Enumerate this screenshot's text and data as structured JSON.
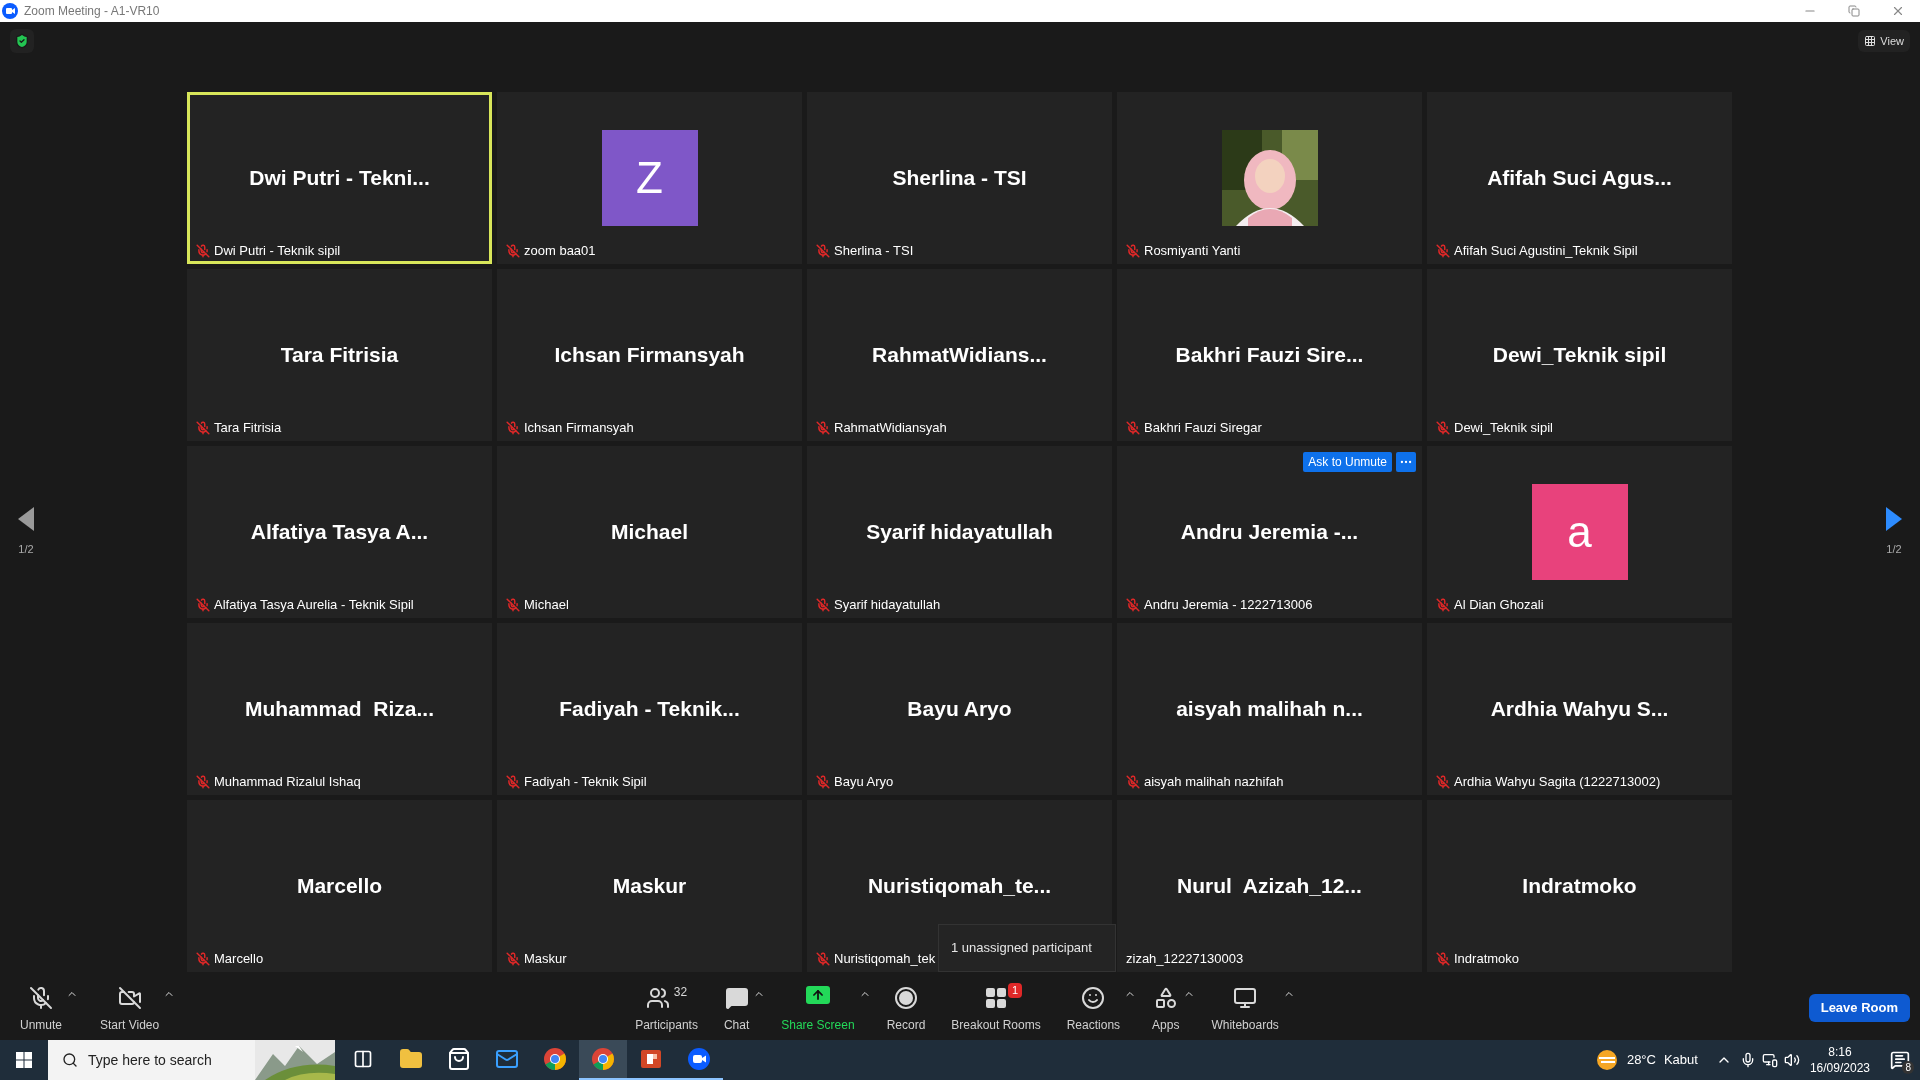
{
  "window": {
    "title": "Zoom Meeting - A1-VR10"
  },
  "view_button": "View",
  "pager": {
    "previous": {
      "label": "1/2",
      "enabled": false
    },
    "next": {
      "label": "1/2",
      "enabled": true
    }
  },
  "tiles": [
    {
      "kind": "name",
      "display": "Dwi Putri - Tekni...",
      "label": "Dwi Putri - Teknik sipil",
      "muted": true,
      "selected": true
    },
    {
      "kind": "avatar",
      "display": "Z",
      "color": "#7f57c8",
      "label": "zoom baa01",
      "muted": true,
      "selected": false
    },
    {
      "kind": "name",
      "display": "Sherlina - TSI",
      "label": "Sherlina - TSI",
      "muted": true,
      "selected": false
    },
    {
      "label": "Rosmiyanti Yanti",
      "muted": true,
      "selected": false
    },
    {
      "kind": "name",
      "display": "Afifah Suci Agus...",
      "label": "Afifah Suci Agustini_Teknik Sipil",
      "muted": true,
      "selected": false
    },
    {
      "kind": "name",
      "display": "Tara Fitrisia",
      "label": "Tara Fitrisia",
      "muted": true,
      "selected": false
    },
    {
      "kind": "name",
      "display": "Ichsan Firmansyah",
      "label": "Ichsan Firmansyah",
      "muted": true,
      "selected": false
    },
    {
      "kind": "name",
      "display": "RahmatWidians...",
      "label": "RahmatWidiansyah",
      "muted": true,
      "selected": false
    },
    {
      "kind": "name",
      "display": "Bakhri Fauzi Sire...",
      "label": "Bakhri Fauzi Siregar",
      "muted": true,
      "selected": false
    },
    {
      "kind": "name",
      "display": "Dewi_Teknik sipil",
      "label": "Dewi_Teknik sipil",
      "muted": true,
      "selected": false
    },
    {
      "kind": "name",
      "display": "Alfatiya Tasya A...",
      "label": "Alfatiya Tasya Aurelia - Teknik Sipil",
      "muted": true,
      "selected": false
    },
    {
      "kind": "name",
      "display": "Michael",
      "label": "Michael",
      "muted": true,
      "selected": false
    },
    {
      "kind": "name",
      "display": "Syarif hidayatullah",
      "label": "Syarif hidayatullah",
      "muted": true,
      "selected": false
    },
    {
      "kind": "name",
      "display": "Andru Jeremia -...",
      "label": "Andru Jeremia - 1222713006",
      "muted": true,
      "selected": false,
      "hover_action": "Ask to Unmute"
    },
    {
      "kind": "avatar",
      "display": "a",
      "color": "#e8427c",
      "label": "Al Dian Ghozali",
      "muted": true,
      "selected": false
    },
    {
      "kind": "name",
      "display": "Muhammad  Riza...",
      "label": "Muhammad Rizalul Ishaq",
      "muted": true,
      "selected": false
    },
    {
      "kind": "name",
      "display": "Fadiyah - Teknik...",
      "label": "Fadiyah - Teknik Sipil",
      "muted": true,
      "selected": false
    },
    {
      "kind": "name",
      "display": "Bayu Aryo",
      "label": "Bayu Aryo",
      "muted": true,
      "selected": false
    },
    {
      "kind": "name",
      "display": "aisyah malihah n...",
      "label": "aisyah malihah nazhifah",
      "muted": true,
      "selected": false
    },
    {
      "kind": "name",
      "display": "Ardhia Wahyu S...",
      "label": "Ardhia Wahyu Sagita (1222713002)",
      "muted": true,
      "selected": false
    },
    {
      "kind": "name",
      "display": "Marcello",
      "label": "Marcello",
      "muted": true,
      "selected": false
    },
    {
      "kind": "name",
      "display": "Maskur",
      "label": "Maskur",
      "muted": true,
      "selected": false
    },
    {
      "kind": "name",
      "display": "Nuristiqomah_te...",
      "label": "Nuristiqomah_tek",
      "muted": true,
      "selected": false
    },
    {
      "kind": "name",
      "display": "Nurul  Azizah_12...",
      "label": "zizah_12227130003",
      "muted": false,
      "selected": false
    },
    {
      "kind": "name",
      "display": "Indratmoko",
      "label": "Indratmoko",
      "muted": true,
      "selected": false
    }
  ],
  "tooltip": "1 unassigned participant",
  "toolbar_left": [
    {
      "kind": "audio",
      "label": "Unmute",
      "caret": true
    },
    {
      "kind": "video",
      "label": "Start Video",
      "caret": true
    }
  ],
  "toolbar_center": [
    {
      "kind": "participants",
      "label": "Participants",
      "count": "32",
      "caret": false
    },
    {
      "kind": "chat",
      "label": "Chat",
      "caret": true
    },
    {
      "kind": "share",
      "label": "Share Screen",
      "caret": true
    },
    {
      "kind": "record",
      "label": "Record",
      "caret": false
    },
    {
      "kind": "breakout",
      "label": "Breakout Rooms",
      "badge": "1",
      "caret": false
    },
    {
      "kind": "reactions",
      "label": "Reactions",
      "caret": true
    },
    {
      "kind": "apps",
      "label": "Apps",
      "caret": true
    },
    {
      "kind": "whiteboards",
      "label": "Whiteboards",
      "caret": true
    }
  ],
  "leave_button": "Leave Room",
  "taskbar": {
    "search_placeholder": "Type here to search",
    "apps": [
      {
        "kind": "taskview",
        "running": false,
        "selected": false
      },
      {
        "kind": "explorer",
        "running": false,
        "selected": false
      },
      {
        "kind": "store",
        "running": false,
        "selected": false
      },
      {
        "kind": "mail",
        "running": false,
        "selected": false
      },
      {
        "kind": "chrome",
        "running": false,
        "selected": false
      },
      {
        "kind": "chrome",
        "running": true,
        "selected": true
      },
      {
        "kind": "powerpoint",
        "running": true,
        "selected": false
      },
      {
        "kind": "zoom",
        "running": true,
        "selected": false
      }
    ],
    "weather": {
      "temperature": "28°C",
      "condition": "Kabut"
    },
    "time": "8:16",
    "date": "16/09/2023",
    "notifications": "8"
  }
}
